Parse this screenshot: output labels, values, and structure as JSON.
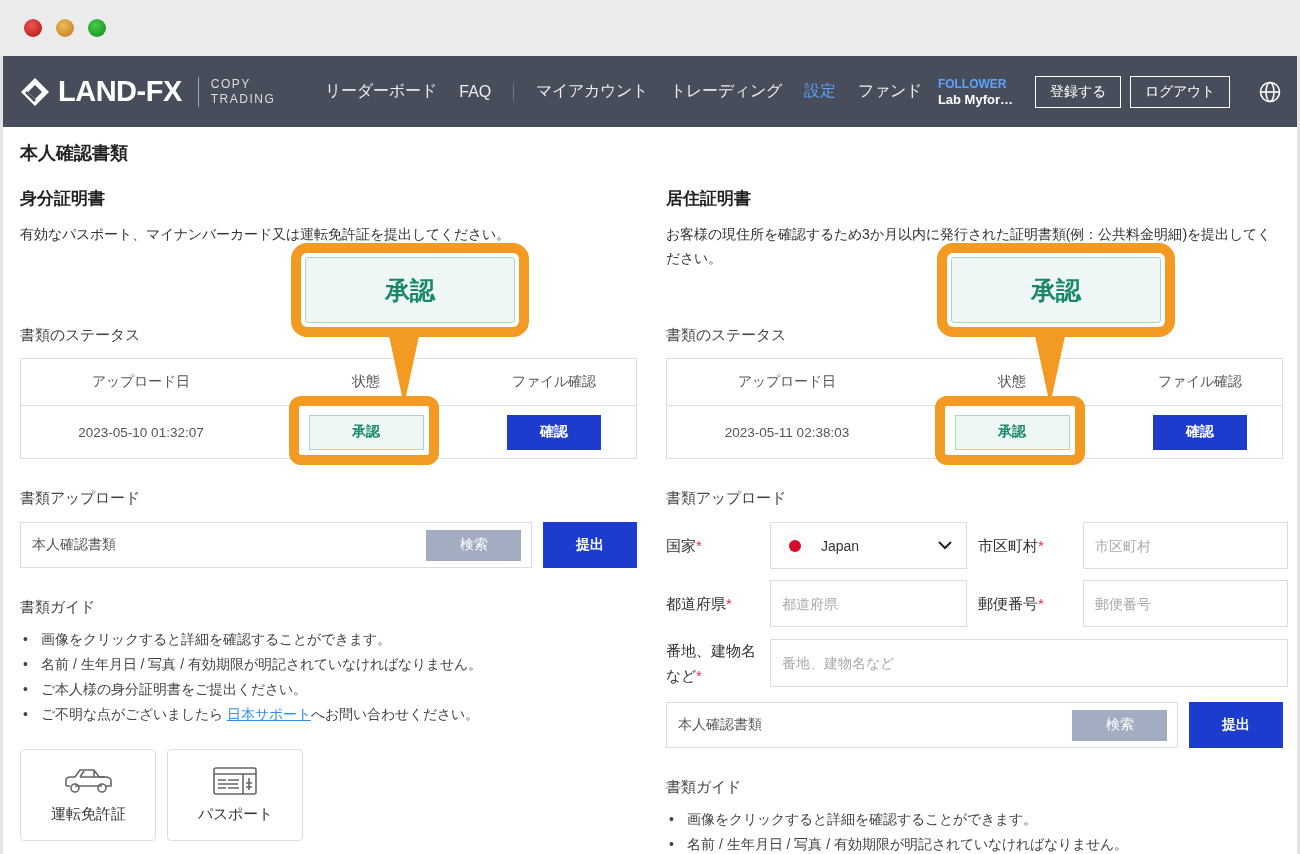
{
  "nav": {
    "logo": "LAND-FX",
    "logo_sub": [
      "COPY",
      "TRADING"
    ],
    "items": [
      {
        "kind": "link",
        "label": "リーダーボード",
        "selected": false
      },
      {
        "kind": "link",
        "label": "FAQ",
        "selected": false
      },
      {
        "kind": "separator"
      },
      {
        "kind": "link",
        "label": "マイアカウント",
        "selected": false
      },
      {
        "kind": "link",
        "label": "トレーディング",
        "selected": false
      },
      {
        "kind": "link",
        "label": "設定",
        "selected": true
      },
      {
        "kind": "link",
        "label": "ファンド",
        "selected": false
      }
    ],
    "user": {
      "role": "FOLLOWER",
      "name": "Lab Myfor…"
    },
    "buttons": [
      "登録する",
      "ログアウト"
    ]
  },
  "page_title": "本人確認書類",
  "sections": [
    {
      "title": "身分証明書",
      "description": "有効なパスポート、マイナンバーカード又は運転免許証を提出してください。",
      "callout": "承認",
      "status_heading": "書類のステータス",
      "table": {
        "columns": [
          "アップロード日",
          "状態",
          "ファイル確認"
        ],
        "rows": [
          {
            "date": "2023-05-10 01:32:07",
            "status": "承認",
            "action": "確認"
          }
        ]
      },
      "upload_heading": "書類アップロード",
      "file": {
        "value": "本人確認書類",
        "browse": "検索",
        "submit": "提出"
      },
      "guide_heading": "書類ガイド",
      "guide": [
        {
          "bullet": "•",
          "text": "画像をクリックすると詳細を確認することができます。"
        },
        {
          "bullet": "•",
          "text": "名前 / 生年月日 / 写真 / 有効期限が明記されていなければなりません。"
        },
        {
          "bullet": "•",
          "text": "ご本人様の身分証明書をご提出ください。"
        },
        {
          "bullet": "•",
          "text": "ご不明な点がございましたら ",
          "link": "日本サポート",
          "after": "へお問い合わせください。"
        }
      ],
      "documents": [
        {
          "kind": "car",
          "label": "運転免許証"
        },
        {
          "kind": "passport",
          "label": "パスポート"
        }
      ]
    },
    {
      "title": "居住証明書",
      "description": "お客様の現住所を確認するため3か月以内に発行された証明書類(例：公共料金明細)を提出してください。",
      "callout": "承認",
      "status_heading": "書類のステータス",
      "table": {
        "columns": [
          "アップロード日",
          "状態",
          "ファイル確認"
        ],
        "rows": [
          {
            "date": "2023-05-11 02:38:03",
            "status": "承認",
            "action": "確認"
          }
        ]
      },
      "upload_heading": "書類アップロード",
      "form": [
        {
          "kind": "select",
          "label": "国家",
          "required_mark": "*",
          "value": "Japan"
        },
        {
          "kind": "text",
          "label": "市区町村",
          "required_mark": "*",
          "placeholder": "市区町村"
        },
        {
          "kind": "text",
          "label": "都道府県",
          "required_mark": "*",
          "placeholder": "都道府県"
        },
        {
          "kind": "text",
          "label": "郵便番号",
          "required_mark": "*",
          "placeholder": "郵便番号"
        },
        {
          "kind": "wide_text",
          "label": "番地、建物名など",
          "required_mark": "*",
          "placeholder": "番地、建物名など"
        }
      ],
      "file": {
        "value": "本人確認書類",
        "browse": "検索",
        "submit": "提出"
      },
      "guide_heading": "書類ガイド",
      "guide": [
        {
          "bullet": "•",
          "text": "画像をクリックすると詳細を確認することができます。"
        },
        {
          "bullet": "•",
          "text": "名前 / 生年月日 / 写真 / 有効期限が明記されていなければなりません。"
        }
      ]
    }
  ]
}
